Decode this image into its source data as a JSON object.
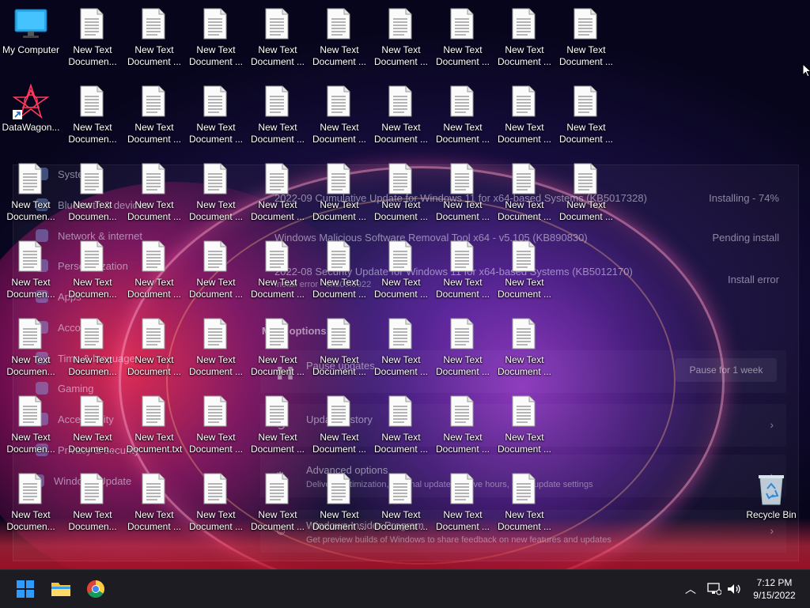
{
  "desktop": {
    "my_computer_label": "My Computer",
    "datawagon_label": "DataWagon...",
    "recycle_bin_label": "Recycle Bin",
    "doc_label_line1": "New Text",
    "doc_label_line2_a": "Documen...",
    "doc_label_line2_b": "Document ...",
    "doc_txt_label_line1": "New Text",
    "doc_txt_label_line2": "Document.txt"
  },
  "settings": {
    "nav": [
      {
        "label": "System"
      },
      {
        "label": "Bluetooth & devices"
      },
      {
        "label": "Network & internet"
      },
      {
        "label": "Personalization"
      },
      {
        "label": "Apps"
      },
      {
        "label": "Accounts"
      },
      {
        "label": "Time & language"
      },
      {
        "label": "Gaming"
      },
      {
        "label": "Accessibility"
      },
      {
        "label": "Privacy & security"
      },
      {
        "label": "Windows Update"
      }
    ],
    "updates": [
      {
        "title": "2022-09 Cumulative Update for Windows 11 for x64-based Systems (KB5017328)",
        "status": "Installing - 74%",
        "sub": ""
      },
      {
        "title": "Windows Malicious Software Removal Tool x64 - v5.105 (KB890830)",
        "status": "Pending install",
        "sub": ""
      },
      {
        "title": "2022-08 Security Update for Windows 11 for x64-based Systems (KB5012170)",
        "status": "Install error",
        "sub": "Install error - 0x800f0922"
      }
    ],
    "more_options": "More options",
    "options": [
      {
        "title": "Pause updates",
        "sub": "",
        "action": "Pause for 1 week"
      },
      {
        "title": "Update history",
        "sub": "",
        "action": ""
      },
      {
        "title": "Advanced options",
        "sub": "Delivery optimization, optional updates, active hours, other update settings",
        "action": ""
      },
      {
        "title": "Windows Insider Program",
        "sub": "Get preview builds of Windows to share feedback on new features and updates",
        "action": ""
      }
    ]
  },
  "taskbar": {
    "time": "7:12 PM",
    "date": "9/15/2022"
  },
  "colors": {
    "taskbar_bg": "#1c1c22",
    "accent": "#0078d4",
    "windows_blue": "#2f9bff"
  }
}
